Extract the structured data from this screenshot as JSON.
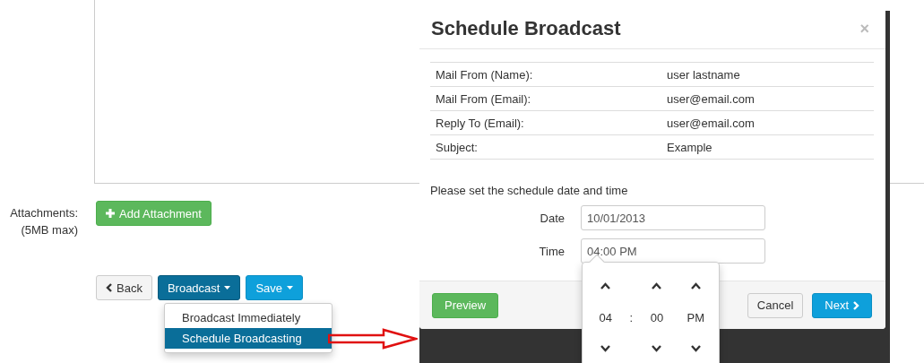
{
  "attachments": {
    "label": "Attachments:",
    "note": "(5MB max)",
    "button": "Add Attachment"
  },
  "actions": [
    {
      "kind": "back",
      "label": "Back",
      "expanded": false
    },
    {
      "kind": "menu",
      "label": "Broadcast",
      "expanded": true
    },
    {
      "kind": "save",
      "label": "Save",
      "expanded": false
    }
  ],
  "broadcast_menu": [
    {
      "label": "Broadcast Immediately",
      "selected": false
    },
    {
      "label": "Schedule Broadcasting",
      "selected": true
    }
  ],
  "modal": {
    "title": "Schedule Broadcast",
    "close": "×",
    "details": [
      {
        "label": "Mail From (Name):",
        "value": "user lastname"
      },
      {
        "label": "Mail From (Email):",
        "value": "user@email.com"
      },
      {
        "label": "Reply To (Email):",
        "value": "user@email.com"
      },
      {
        "label": "Subject:",
        "value": "Example"
      }
    ],
    "prompt": "Please set the schedule date and time",
    "fields": [
      {
        "label": "Date",
        "value": "10/01/2013"
      },
      {
        "label": "Time",
        "value": "04:00 PM"
      }
    ],
    "time_picker": {
      "hour": "04",
      "separator": ":",
      "minute": "00",
      "period": "PM"
    },
    "footer": {
      "preview": "Preview",
      "cancel": "Cancel",
      "next": "Next"
    }
  }
}
